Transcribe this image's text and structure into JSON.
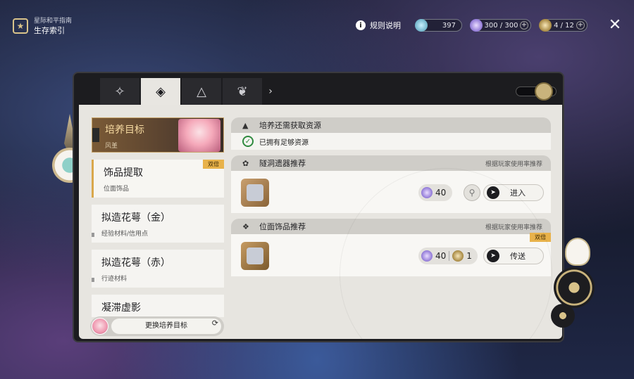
{
  "header": {
    "subtitle": "星际和平指南",
    "title": "生存索引",
    "rules_label": "规则说明",
    "currency_1": "397",
    "stamina": "300 / 300",
    "reserve": "4 / 12"
  },
  "tabs": {
    "icons": [
      "guide-icon",
      "cultivation-icon",
      "echo-icon",
      "lotus-icon"
    ],
    "active_index": 1
  },
  "left": {
    "target_title": "培养目标",
    "target_name": "风堇",
    "items": [
      {
        "name": "饰品提取",
        "desc": "位面饰品",
        "badge": "双倍"
      },
      {
        "name": "拟造花萼（金）",
        "desc": "经验材料/信用点"
      },
      {
        "name": "拟造花萼（赤）",
        "desc": "行迹材料"
      },
      {
        "name": "凝滞虚影",
        "desc": ""
      }
    ],
    "swap_label": "更换培养目标"
  },
  "right": {
    "need_title": "培养还需获取资源",
    "need_status": "已拥有足够资源",
    "cavern": {
      "title": "隧洞遗器推荐",
      "note": "根据玩家使用率推荐",
      "cost": "40",
      "action": "进入"
    },
    "planar": {
      "title": "位面饰品推荐",
      "note": "根据玩家使用率推荐",
      "badge": "双倍",
      "cost": "40",
      "cost2": "1",
      "action": "传送"
    }
  },
  "colors": {
    "accent_gold": "#e8b24a",
    "check_green": "#2f8a3f",
    "panel_bg": "#e7e5e0"
  }
}
